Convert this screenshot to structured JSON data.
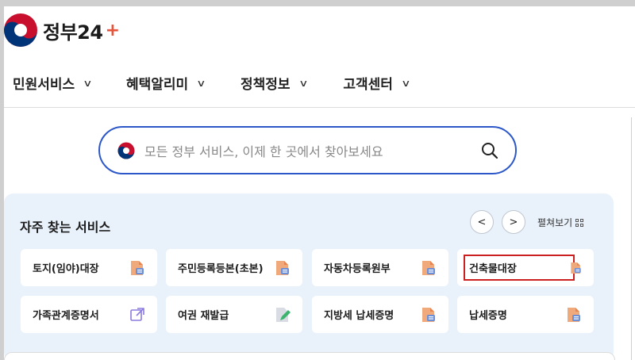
{
  "logo": {
    "text": "정부24",
    "plus": "+"
  },
  "nav": [
    {
      "label": "민원서비스"
    },
    {
      "label": "혜택알리미"
    },
    {
      "label": "정책정보"
    },
    {
      "label": "고객센터"
    }
  ],
  "search": {
    "placeholder": "모든 정부 서비스, 이제 한 곳에서 찾아보세요"
  },
  "frequent": {
    "title": "자주 찾는 서비스",
    "prev": "<",
    "next": ">",
    "expand": "펼쳐보기",
    "items": [
      {
        "label": "토지(임야)대장",
        "icon": "pdf-document-icon"
      },
      {
        "label": "주민등록등본(초본)",
        "icon": "pdf-document-icon"
      },
      {
        "label": "자동차등록원부",
        "icon": "pdf-document-icon"
      },
      {
        "label": "건축물대장",
        "icon": "pdf-document-icon"
      },
      {
        "label": "가족관계증명서",
        "icon": "external-link-icon"
      },
      {
        "label": "여권 재발급",
        "icon": "edit-document-icon"
      },
      {
        "label": "지방세 납세증명",
        "icon": "pdf-document-icon"
      },
      {
        "label": "납세증명",
        "icon": "pdf-document-icon"
      }
    ]
  },
  "colors": {
    "accent": "#2b57c8",
    "highlight": "#cc1f1f",
    "panel": "#e9f2fb",
    "pdf": "#e8854f"
  }
}
